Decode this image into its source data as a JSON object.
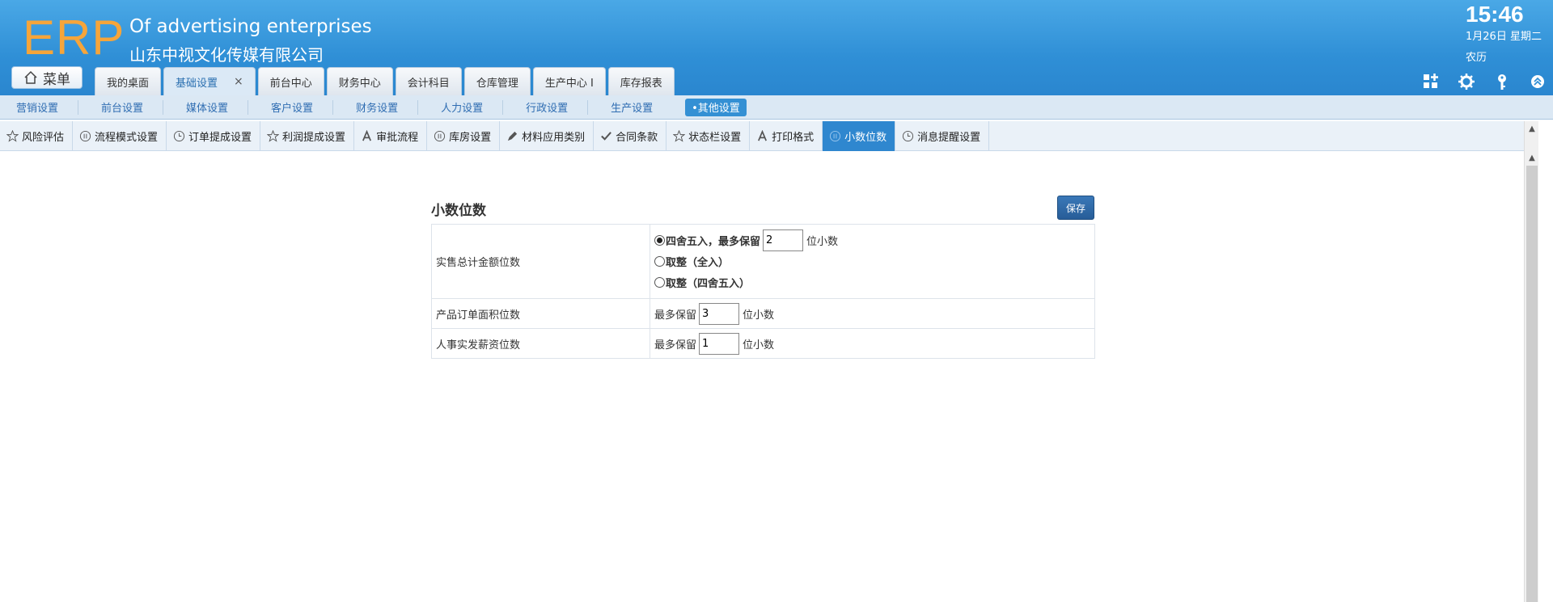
{
  "header": {
    "logo": "ERP",
    "company_en": "Of advertising enterprises",
    "company_cn": "山东中视文化传媒有限公司",
    "clock": "15:46",
    "date": "1月26日 星期二",
    "lunar": "农历",
    "menu_label": "菜单",
    "icons": [
      "grid-add-icon",
      "gear-icon",
      "key-icon",
      "collapse-up-icon"
    ]
  },
  "main_tabs": [
    {
      "label": "我的桌面",
      "active": false
    },
    {
      "label": "基础设置",
      "active": true,
      "close": "×"
    },
    {
      "label": "前台中心",
      "active": false
    },
    {
      "label": "财务中心",
      "active": false
    },
    {
      "label": "会计科目",
      "active": false
    },
    {
      "label": "仓库管理",
      "active": false
    },
    {
      "label": "生产中心 I",
      "active": false
    },
    {
      "label": "库存报表",
      "active": false
    }
  ],
  "subnav": [
    {
      "label": "营销设置"
    },
    {
      "label": "前台设置"
    },
    {
      "label": "媒体设置"
    },
    {
      "label": "客户设置"
    },
    {
      "label": "财务设置"
    },
    {
      "label": "人力设置"
    },
    {
      "label": "行政设置"
    },
    {
      "label": "生产设置"
    },
    {
      "label": "•其他设置",
      "active": true
    }
  ],
  "subtabs": [
    {
      "label": "风险评估",
      "icon": "star-icon"
    },
    {
      "label": "流程模式设置",
      "icon": "pause-circle-icon"
    },
    {
      "label": "订单提成设置",
      "icon": "clock-icon"
    },
    {
      "label": "利润提成设置",
      "icon": "star-icon"
    },
    {
      "label": "审批流程",
      "icon": "font-a-icon"
    },
    {
      "label": "库房设置",
      "icon": "pause-circle-icon"
    },
    {
      "label": "材料应用类别",
      "icon": "pencil-icon"
    },
    {
      "label": "合同条款",
      "icon": "check-icon"
    },
    {
      "label": "状态栏设置",
      "icon": "star-icon"
    },
    {
      "label": "打印格式",
      "icon": "font-a-icon"
    },
    {
      "label": "小数位数",
      "icon": "pause-circle-icon",
      "active": true
    },
    {
      "label": "消息提醒设置",
      "icon": "clock-icon"
    }
  ],
  "form": {
    "title": "小数位数",
    "save_label": "保存",
    "rows": {
      "sales_total": {
        "label": "实售总计金额位数",
        "option_round": "四舍五入，最多保留",
        "option_round_value": "2",
        "option_round_unit": "位小数",
        "option_ceil": "取整（全入）",
        "option_round_int": "取整（四舍五入）"
      },
      "order_area": {
        "label": "产品订单面积位数",
        "prefix": "最多保留",
        "value": "3",
        "unit": "位小数"
      },
      "salary": {
        "label": "人事实发薪资位数",
        "prefix": "最多保留",
        "value": "1",
        "unit": "位小数"
      }
    }
  },
  "colors": {
    "header_blue": "#2f8fd6",
    "logo_orange": "#f6a53a",
    "active_tab_blue": "#2f87cf"
  }
}
